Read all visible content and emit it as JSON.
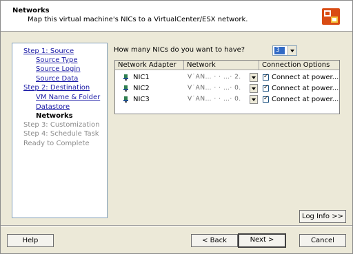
{
  "header": {
    "title": "Networks",
    "subtitle": "Map this virtual machine's NICs to a VirtualCenter/ESX network."
  },
  "sidebar": {
    "steps": [
      {
        "label": "Step 1: Source",
        "state": "link"
      },
      {
        "label": "Source Type",
        "state": "link"
      },
      {
        "label": "Source Login",
        "state": "link"
      },
      {
        "label": "Source Data",
        "state": "link"
      },
      {
        "label": "Step 2: Destination",
        "state": "link"
      },
      {
        "label": "VM Name & Folder",
        "state": "link"
      },
      {
        "label": "Datastore",
        "state": "link"
      },
      {
        "label": "Networks",
        "state": "current"
      },
      {
        "label": "Step 3: Customization",
        "state": "disabled"
      },
      {
        "label": "Step 4: Schedule Task",
        "state": "disabled"
      },
      {
        "label": "Ready to Complete",
        "state": "disabled"
      }
    ]
  },
  "nic_count": {
    "question": "How many NICs do you want to have?",
    "value": "3"
  },
  "table": {
    "columns": [
      "Network Adapter",
      "Network",
      "Connection Options"
    ],
    "rows": [
      {
        "adapter": "NIC1",
        "network": "V˙AN… · · …· 2.",
        "option": "Connect at power...",
        "checked": true
      },
      {
        "adapter": "NIC2",
        "network": "V˙AN… · · …· 0.",
        "option": "Connect at power...",
        "checked": true
      },
      {
        "adapter": "NIC3",
        "network": "V˙AN… · · …· 0.",
        "option": "Connect at power...",
        "checked": true
      }
    ]
  },
  "buttons": {
    "log_info": "Log Info >>",
    "help": "Help",
    "back": "< Back",
    "next": "Next >",
    "cancel": "Cancel"
  },
  "colors": {
    "link": "#1a1aa6",
    "disabled": "#8b8b8b",
    "selection": "#316ac5"
  },
  "icons": {
    "logo": "vmware-converter-icon",
    "nic": "network-adapter-icon",
    "check": "checkbox-checked-icon"
  }
}
